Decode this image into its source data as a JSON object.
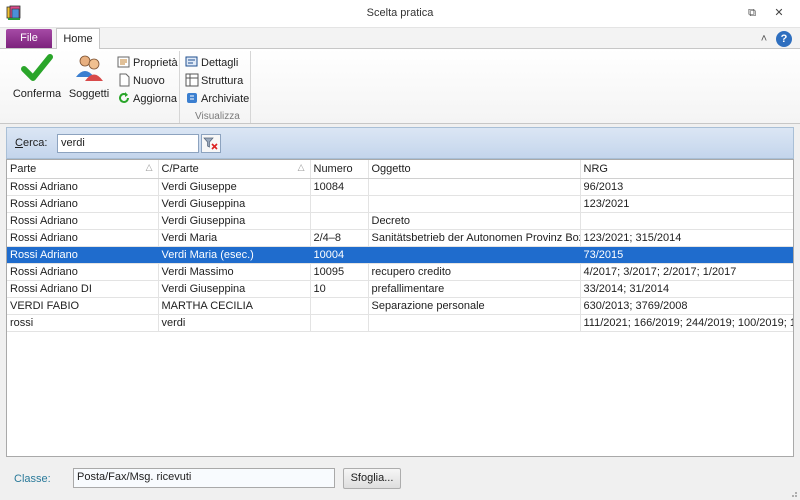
{
  "window": {
    "title": "Scelta pratica",
    "restore_glyph": "⧉",
    "close_glyph": "✕"
  },
  "ribbon_tabs": {
    "file": "File",
    "home": "Home",
    "collapse_glyph": "˄",
    "help_glyph": "?"
  },
  "ribbon": {
    "conferma": "Conferma",
    "soggetti": "Soggetti",
    "proprieta": "Proprietà",
    "nuovo": "Nuovo",
    "aggiorna": "Aggiorna",
    "dettagli": "Dettagli",
    "struttura": "Struttura",
    "archiviate": "Archiviate",
    "group_visualizza": "Visualizza"
  },
  "search": {
    "label_first": "C",
    "label_rest": "erca:",
    "value": "verdi"
  },
  "grid": {
    "columns": [
      "Parte",
      "C/Parte",
      "Numero",
      "Oggetto",
      "NRG"
    ],
    "sort_glyph": "△",
    "rows": [
      {
        "parte": "Rossi Adriano",
        "cparte": "Verdi Giuseppe",
        "numero": "10084",
        "oggetto": "",
        "nrg": "96/2013"
      },
      {
        "parte": "Rossi Adriano",
        "cparte": "Verdi Giuseppina",
        "numero": "",
        "oggetto": "",
        "nrg": "123/2021"
      },
      {
        "parte": "Rossi Adriano",
        "cparte": "Verdi Giuseppina",
        "numero": "",
        "oggetto": "Decreto",
        "nrg": ""
      },
      {
        "parte": "Rossi Adriano",
        "cparte": "Verdi Maria",
        "numero": "2/4–8",
        "oggetto": "Sanitätsbetrieb der Autonomen Provinz Bozen",
        "nrg": "123/2021; 315/2014"
      },
      {
        "parte": "Rossi Adriano",
        "cparte": "Verdi Maria (esec.)",
        "numero": "10004",
        "oggetto": "",
        "nrg": "73/2015"
      },
      {
        "parte": "Rossi Adriano",
        "cparte": "Verdi Massimo",
        "numero": "10095",
        "oggetto": "recupero credito",
        "nrg": "4/2017; 3/2017; 2/2017; 1/2017"
      },
      {
        "parte": "Rossi Adriano DI",
        "cparte": "Verdi Giuseppina",
        "numero": "10",
        "oggetto": "prefallimentare",
        "nrg": "33/2014; 31/2014"
      },
      {
        "parte": "VERDI FABIO",
        "cparte": "MARTHA CECILIA",
        "numero": "",
        "oggetto": "Separazione personale",
        "nrg": "630/2013; 3769/2008"
      },
      {
        "parte": "rossi",
        "cparte": "verdi",
        "numero": "",
        "oggetto": "",
        "nrg": "111/2021; 166/2019; 244/2019; 100/2019; 1"
      }
    ]
  },
  "footer": {
    "classe_label": "Classe:",
    "classe_value": "Posta/Fax/Msg. ricevuti",
    "sfoglia": "Sfoglia..."
  }
}
